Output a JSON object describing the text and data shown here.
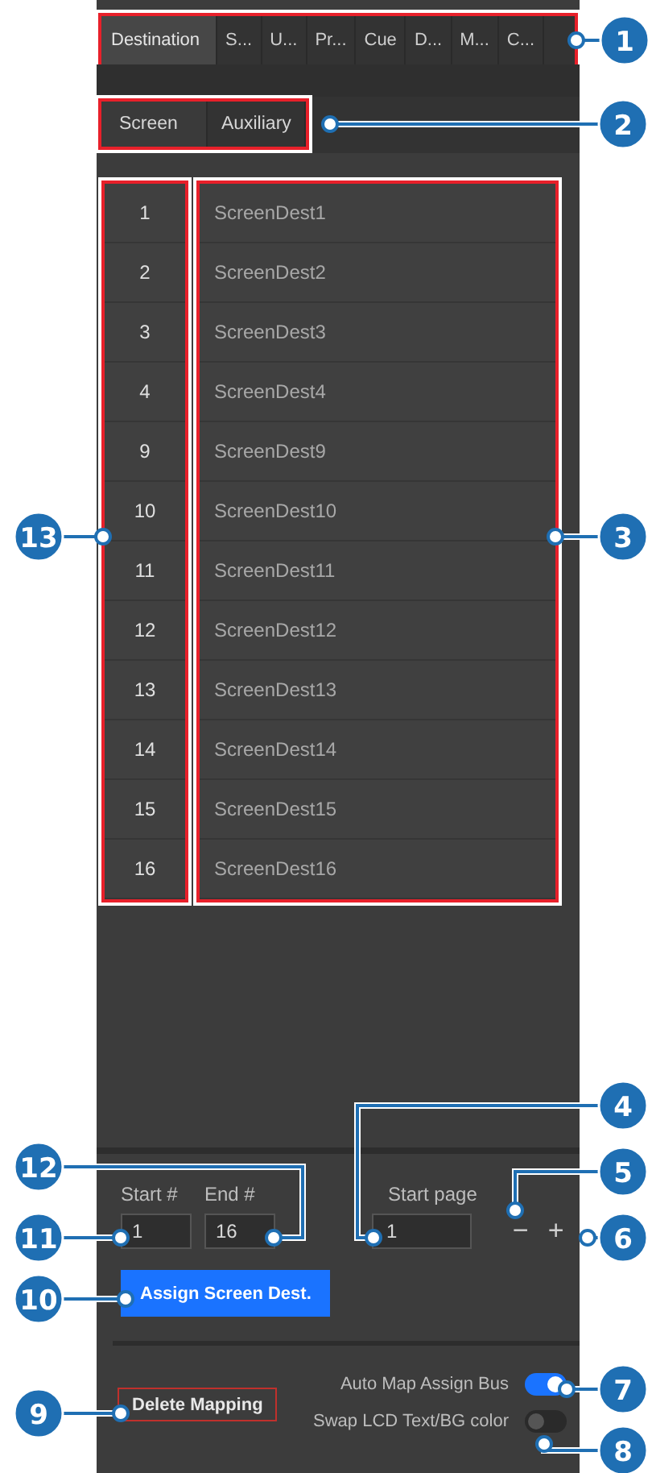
{
  "destination_tabs": [
    {
      "label": "Destination",
      "selected": true
    },
    {
      "label": "S...",
      "selected": false
    },
    {
      "label": "U...",
      "selected": false
    },
    {
      "label": "Pr...",
      "selected": false
    },
    {
      "label": "Cue",
      "selected": false
    },
    {
      "label": "D...",
      "selected": false
    },
    {
      "label": "M...",
      "selected": false
    },
    {
      "label": "C...",
      "selected": false
    }
  ],
  "sub_tabs": [
    {
      "label": "Screen",
      "selected": true
    },
    {
      "label": "Auxiliary",
      "selected": false
    }
  ],
  "rows": [
    {
      "number": "1",
      "name": "ScreenDest1"
    },
    {
      "number": "2",
      "name": "ScreenDest2"
    },
    {
      "number": "3",
      "name": "ScreenDest3"
    },
    {
      "number": "4",
      "name": "ScreenDest4"
    },
    {
      "number": "9",
      "name": "ScreenDest9"
    },
    {
      "number": "10",
      "name": "ScreenDest10"
    },
    {
      "number": "11",
      "name": "ScreenDest11"
    },
    {
      "number": "12",
      "name": "ScreenDest12"
    },
    {
      "number": "13",
      "name": "ScreenDest13"
    },
    {
      "number": "14",
      "name": "ScreenDest14"
    },
    {
      "number": "15",
      "name": "ScreenDest15"
    },
    {
      "number": "16",
      "name": "ScreenDest16"
    }
  ],
  "start_field": {
    "label": "Start #",
    "value": "1"
  },
  "end_field": {
    "label": "End #",
    "value": "16"
  },
  "start_page_field": {
    "label": "Start page",
    "value": "1"
  },
  "page_buttons": [
    "−",
    "+"
  ],
  "assign_button": "Assign Screen Dest.",
  "delete_button": "Delete Mapping",
  "toggles": [
    {
      "label": "Auto Map Assign Bus",
      "on": true
    },
    {
      "label": "Swap LCD Text/BG color",
      "on": false
    }
  ],
  "callouts": [
    "1",
    "2",
    "13",
    "3",
    "4",
    "12",
    "5",
    "11",
    "6",
    "10",
    "7",
    "9",
    "8"
  ]
}
